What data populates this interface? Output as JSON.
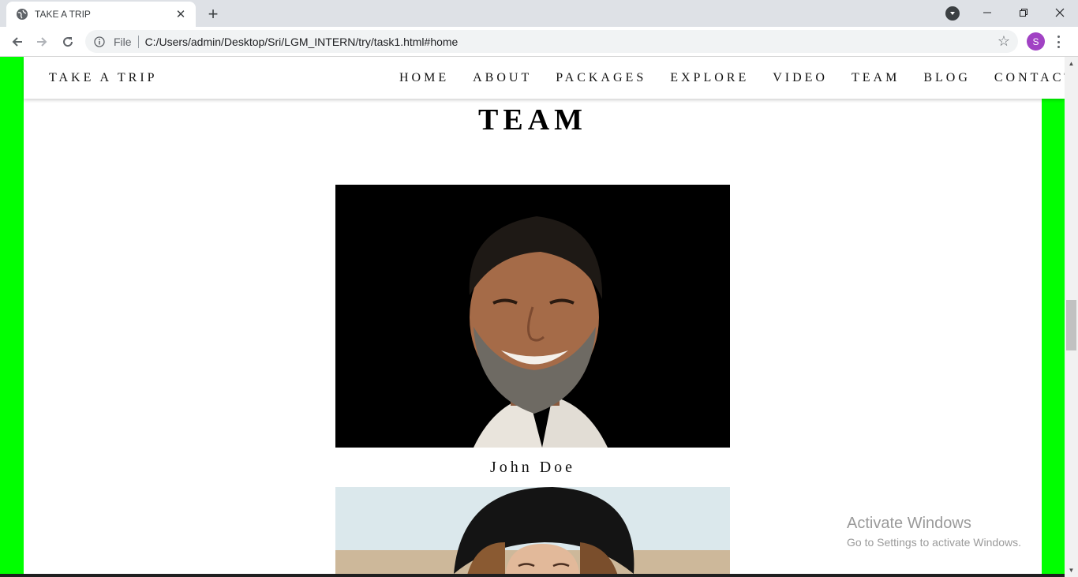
{
  "browser": {
    "tab_title": "TAKE A TRIP",
    "scheme_label": "File",
    "url": "C:/Users/admin/Desktop/Sri/LGM_INTERN/try/task1.html#home",
    "profile_initial": "S",
    "profile_color": "#a142c4"
  },
  "site": {
    "brand": "TAKE A TRIP",
    "menu": [
      "HOME",
      "ABOUT",
      "PACKAGES",
      "EXPLORE",
      "VIDEO",
      "TEAM",
      "BLOG",
      "CONTACT"
    ],
    "section_title": "TEAM",
    "members": [
      {
        "name": "John Doe"
      }
    ],
    "side_color": "#00ff00"
  },
  "os": {
    "watermark_title": "Activate Windows",
    "watermark_sub": "Go to Settings to activate Windows."
  }
}
